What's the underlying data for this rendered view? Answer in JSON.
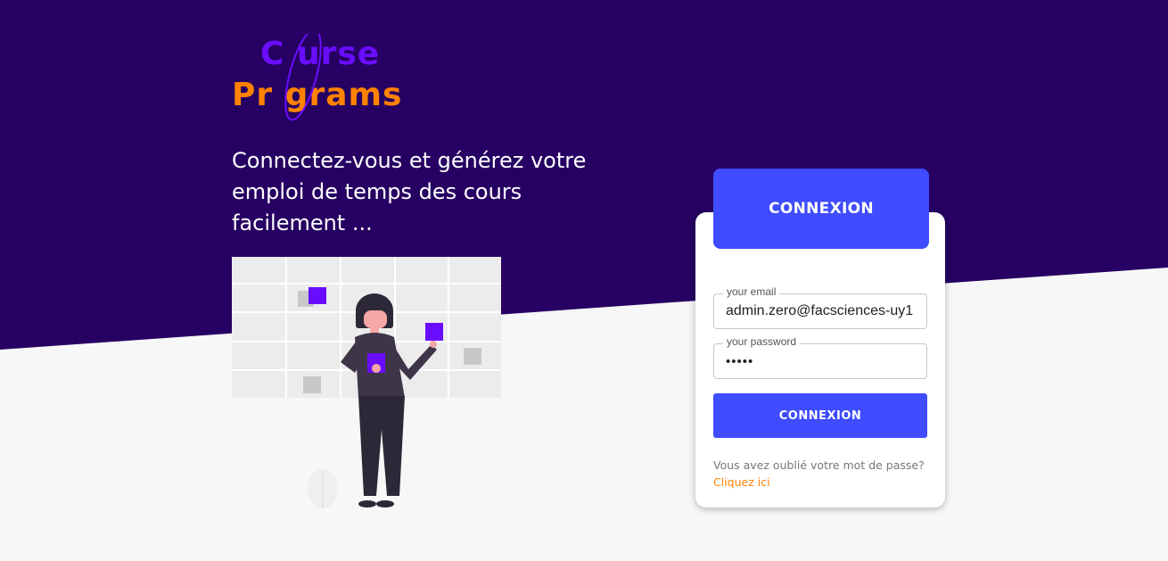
{
  "brand": {
    "line1": "C urse",
    "line2": "Pr  grams",
    "colors": {
      "primary": "#6a0dff",
      "secondary": "#ff8200",
      "banner": "#260062",
      "accent": "#3f4cff"
    }
  },
  "hero": {
    "tagline": "Connectez-vous et générez votre emploi de temps des cours facilement ..."
  },
  "login": {
    "header": "CONNEXION",
    "email": {
      "label": "your email",
      "value": "admin.zero@facsciences-uy1"
    },
    "password": {
      "label": "your password",
      "value": "•••••"
    },
    "submit_label": "CONNEXION",
    "forgot_text": "Vous avez oublié votre mot de passe?",
    "forgot_link": "Cliquez ici"
  },
  "icons": {
    "illustration": "person-calendar-illustration",
    "logo-ring": "logo-ring-icon",
    "plant": "plant-icon"
  }
}
